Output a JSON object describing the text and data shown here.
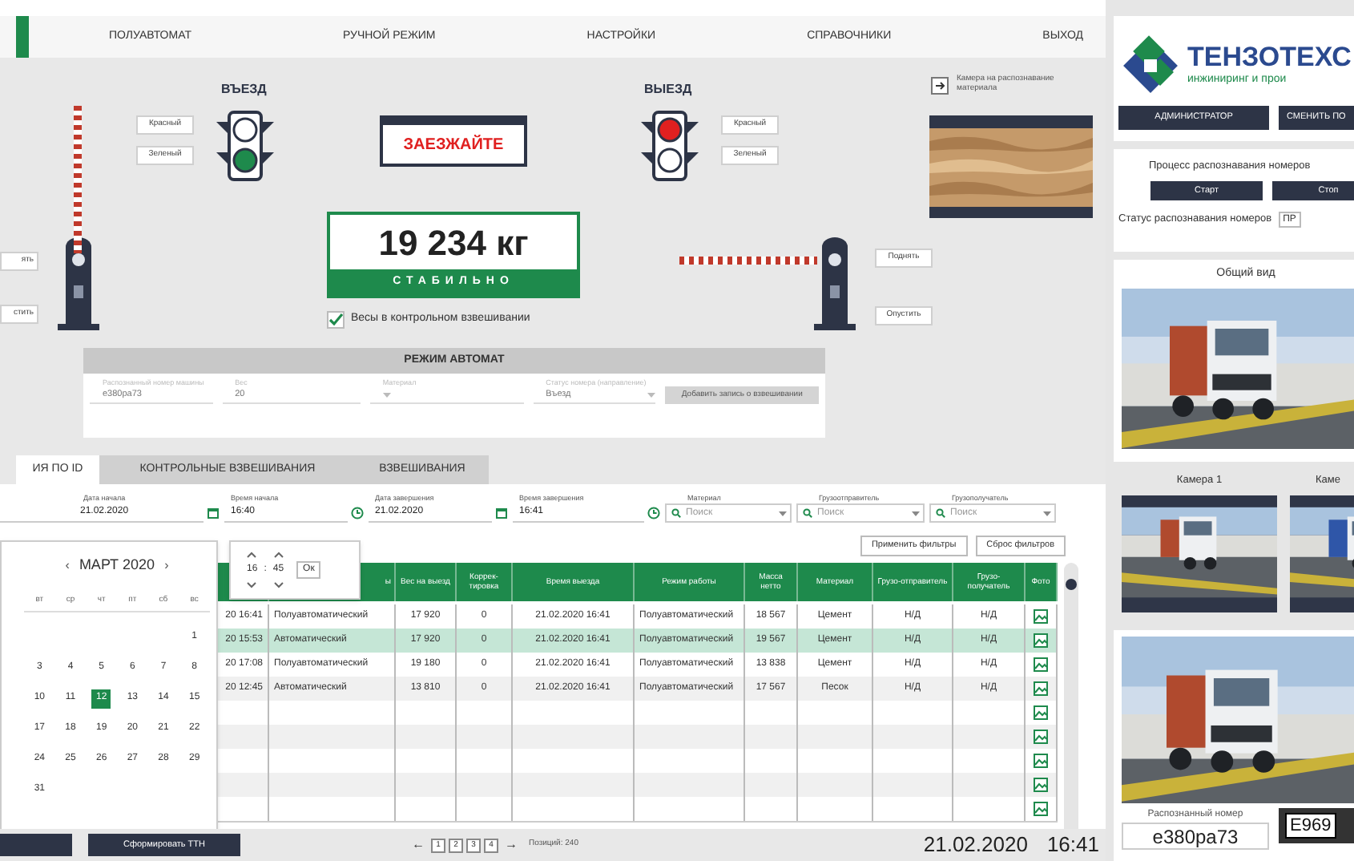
{
  "nav": {
    "items": [
      "ПОЛУАВТОМАТ",
      "РУЧНОЙ РЕЖИМ",
      "НАСТРОЙКИ",
      "СПРАВОЧНИКИ",
      "ВЫХОД"
    ]
  },
  "entry": {
    "title": "ВЪЕЗД",
    "red_on": false,
    "green_on": true,
    "buttons": [
      "Красный",
      "Зеленый"
    ]
  },
  "exit": {
    "title": "ВЫЕЗД",
    "red_on": true,
    "green_on": false,
    "buttons": [
      "Красный",
      "Зеленый"
    ]
  },
  "sign": "ЗАЕЗЖАЙТЕ",
  "left_barrier": {
    "raised": true,
    "buttons": [
      "ять",
      "стить"
    ]
  },
  "right_barrier": {
    "raised": false,
    "buttons": [
      "Поднять",
      "Опустить"
    ]
  },
  "scale": {
    "weight": "19 234 кг",
    "status": "СТАБИЛЬНО",
    "stable": true
  },
  "control_weighing": {
    "label": "Весы в контрольном взвешивании",
    "checked": true
  },
  "camera": {
    "label": "Камера на распознавание материала"
  },
  "auto_mode": {
    "title": "РЕЖИМ АВТОМАТ",
    "disabled": true,
    "fields": [
      {
        "label": "Распознанный номер машины",
        "value": "e380pa73"
      },
      {
        "label": "Вес",
        "value": "20"
      },
      {
        "label": "Материал"
      },
      {
        "label": "Статус номера (направление)",
        "value": "Въезд"
      }
    ],
    "button": "Добавить запись о взвешивании"
  },
  "tabs": [
    {
      "label": "ИЯ ПО ID",
      "selected": true
    },
    {
      "label": "КОНТРОЛЬНЫЕ ВЗВЕШИВАНИЯ",
      "selected": false
    },
    {
      "label": "ВЗВЕШИВАНИЯ",
      "selected": false
    }
  ],
  "filters": [
    {
      "kind": "date",
      "label": "Дата начала",
      "value": "21.02.2020"
    },
    {
      "kind": "time",
      "label": "Время начала",
      "value": "16:40"
    },
    {
      "kind": "date",
      "label": "Дата завершения",
      "value": "21.02.2020"
    },
    {
      "kind": "time",
      "label": "Время завершения",
      "value": "16:41"
    },
    {
      "kind": "search",
      "label": "Материал",
      "placeholder": "Поиск"
    },
    {
      "kind": "search",
      "label": "Грузоотправитель",
      "placeholder": "Поиск"
    },
    {
      "kind": "search",
      "label": "Грузополучатель",
      "placeholder": "Поиск"
    }
  ],
  "filter_buttons": [
    "Применить фильтры",
    "Сброс фильтров"
  ],
  "table": {
    "columns": [
      {},
      {
        "label": "ы"
      },
      {
        "label": "Вес на выезд"
      },
      {
        "label": "Коррек-тировка"
      },
      {
        "label": "Время выезда"
      },
      {
        "label": "Режим работы"
      },
      {
        "label": "Масса нетто"
      },
      {
        "label": "Материал"
      },
      {
        "label": "Грузо-отправитель"
      },
      {
        "label": "Грузо-получатель"
      },
      {
        "label": "Фото"
      }
    ],
    "rows": [
      {
        "selected": false,
        "cells": [
          "20 16:41",
          "Полуавтоматический",
          "17 920",
          "0",
          "21.02.2020 16:41",
          "Полуавтоматический",
          "18 567",
          "Цемент",
          "Н/Д",
          "Н/Д"
        ]
      },
      {
        "selected": true,
        "cells": [
          "20 15:53",
          "Автоматический",
          "17 920",
          "0",
          "21.02.2020 16:41",
          "Полуавтоматический",
          "19 567",
          "Цемент",
          "Н/Д",
          "Н/Д"
        ]
      },
      {
        "selected": false,
        "cells": [
          "20 17:08",
          "Полуавтоматический",
          "19 180",
          "0",
          "21.02.2020 16:41",
          "Полуавтоматический",
          "13 838",
          "Цемент",
          "Н/Д",
          "Н/Д"
        ]
      },
      {
        "selected": false,
        "cells": [
          "20 12:45",
          "Автоматический",
          "13 810",
          "0",
          "21.02.2020 16:41",
          "Полуавтоматический",
          "17 567",
          "Песок",
          "Н/Д",
          "Н/Д"
        ]
      },
      {
        "selected": false
      },
      {
        "selected": false
      },
      {
        "selected": false
      },
      {
        "selected": false
      },
      {
        "selected": false
      }
    ]
  },
  "calendar": {
    "prev": "‹",
    "month": "МАРТ 2020",
    "next": "›",
    "weekdays": [
      "вт",
      "ср",
      "чт",
      "пт",
      "сб",
      "вс"
    ],
    "weeks": [
      [
        {
          "label": "1",
          "selected": false
        }
      ],
      [
        {
          "label": "3",
          "selected": false
        },
        {
          "label": "4",
          "selected": false
        },
        {
          "label": "5",
          "selected": false
        },
        {
          "label": "6",
          "selected": false
        },
        {
          "label": "7",
          "selected": false
        },
        {
          "label": "8",
          "selected": false
        }
      ],
      [
        {
          "label": "10",
          "selected": false
        },
        {
          "label": "11",
          "selected": false
        },
        {
          "label": "12",
          "selected": true
        },
        {
          "label": "13",
          "selected": false
        },
        {
          "label": "14",
          "selected": false
        },
        {
          "label": "15",
          "selected": false
        }
      ],
      [
        {
          "label": "17",
          "selected": false
        },
        {
          "label": "18",
          "selected": false
        },
        {
          "label": "19",
          "selected": false
        },
        {
          "label": "20",
          "selected": false
        },
        {
          "label": "21",
          "selected": false
        },
        {
          "label": "22",
          "selected": false
        }
      ],
      [
        {
          "label": "24",
          "selected": false
        },
        {
          "label": "25",
          "selected": false
        },
        {
          "label": "26",
          "selected": false
        },
        {
          "label": "27",
          "selected": false
        },
        {
          "label": "28",
          "selected": false
        },
        {
          "label": "29",
          "selected": false
        }
      ],
      [
        {
          "label": "31",
          "selected": false
        }
      ]
    ]
  },
  "time_picker": {
    "hours": "16",
    "separator": ":",
    "minutes": "45",
    "ok": "Ок"
  },
  "bottom": {
    "button": "Сформировать ТТН",
    "pagination": {
      "prev": "←",
      "pages": [
        "1",
        "2",
        "3",
        "4"
      ],
      "next": "→",
      "total": "Позиций: 240"
    },
    "date": "21.02.2020",
    "time": "16:41"
  },
  "logo": {
    "name": "ТЕНЗОТЕХС",
    "tagline": "инжиниринг и прои"
  },
  "user_buttons": [
    "АДМИНИСТРАТОР",
    "СМЕНИТЬ ПО"
  ],
  "recognition": {
    "title": "Процесс распознавания номеров",
    "buttons": [
      "Старт",
      "Стоп"
    ],
    "status_label": "Статус распознавания номеров",
    "status_value": "ПР"
  },
  "general_view": {
    "title": "Общий вид"
  },
  "cameras": [
    {
      "title": "Камера 1"
    },
    {
      "title": "Каме"
    }
  ],
  "recognized": {
    "label": "Распознанный номер",
    "value": "e380pa73",
    "plate": "E969"
  }
}
